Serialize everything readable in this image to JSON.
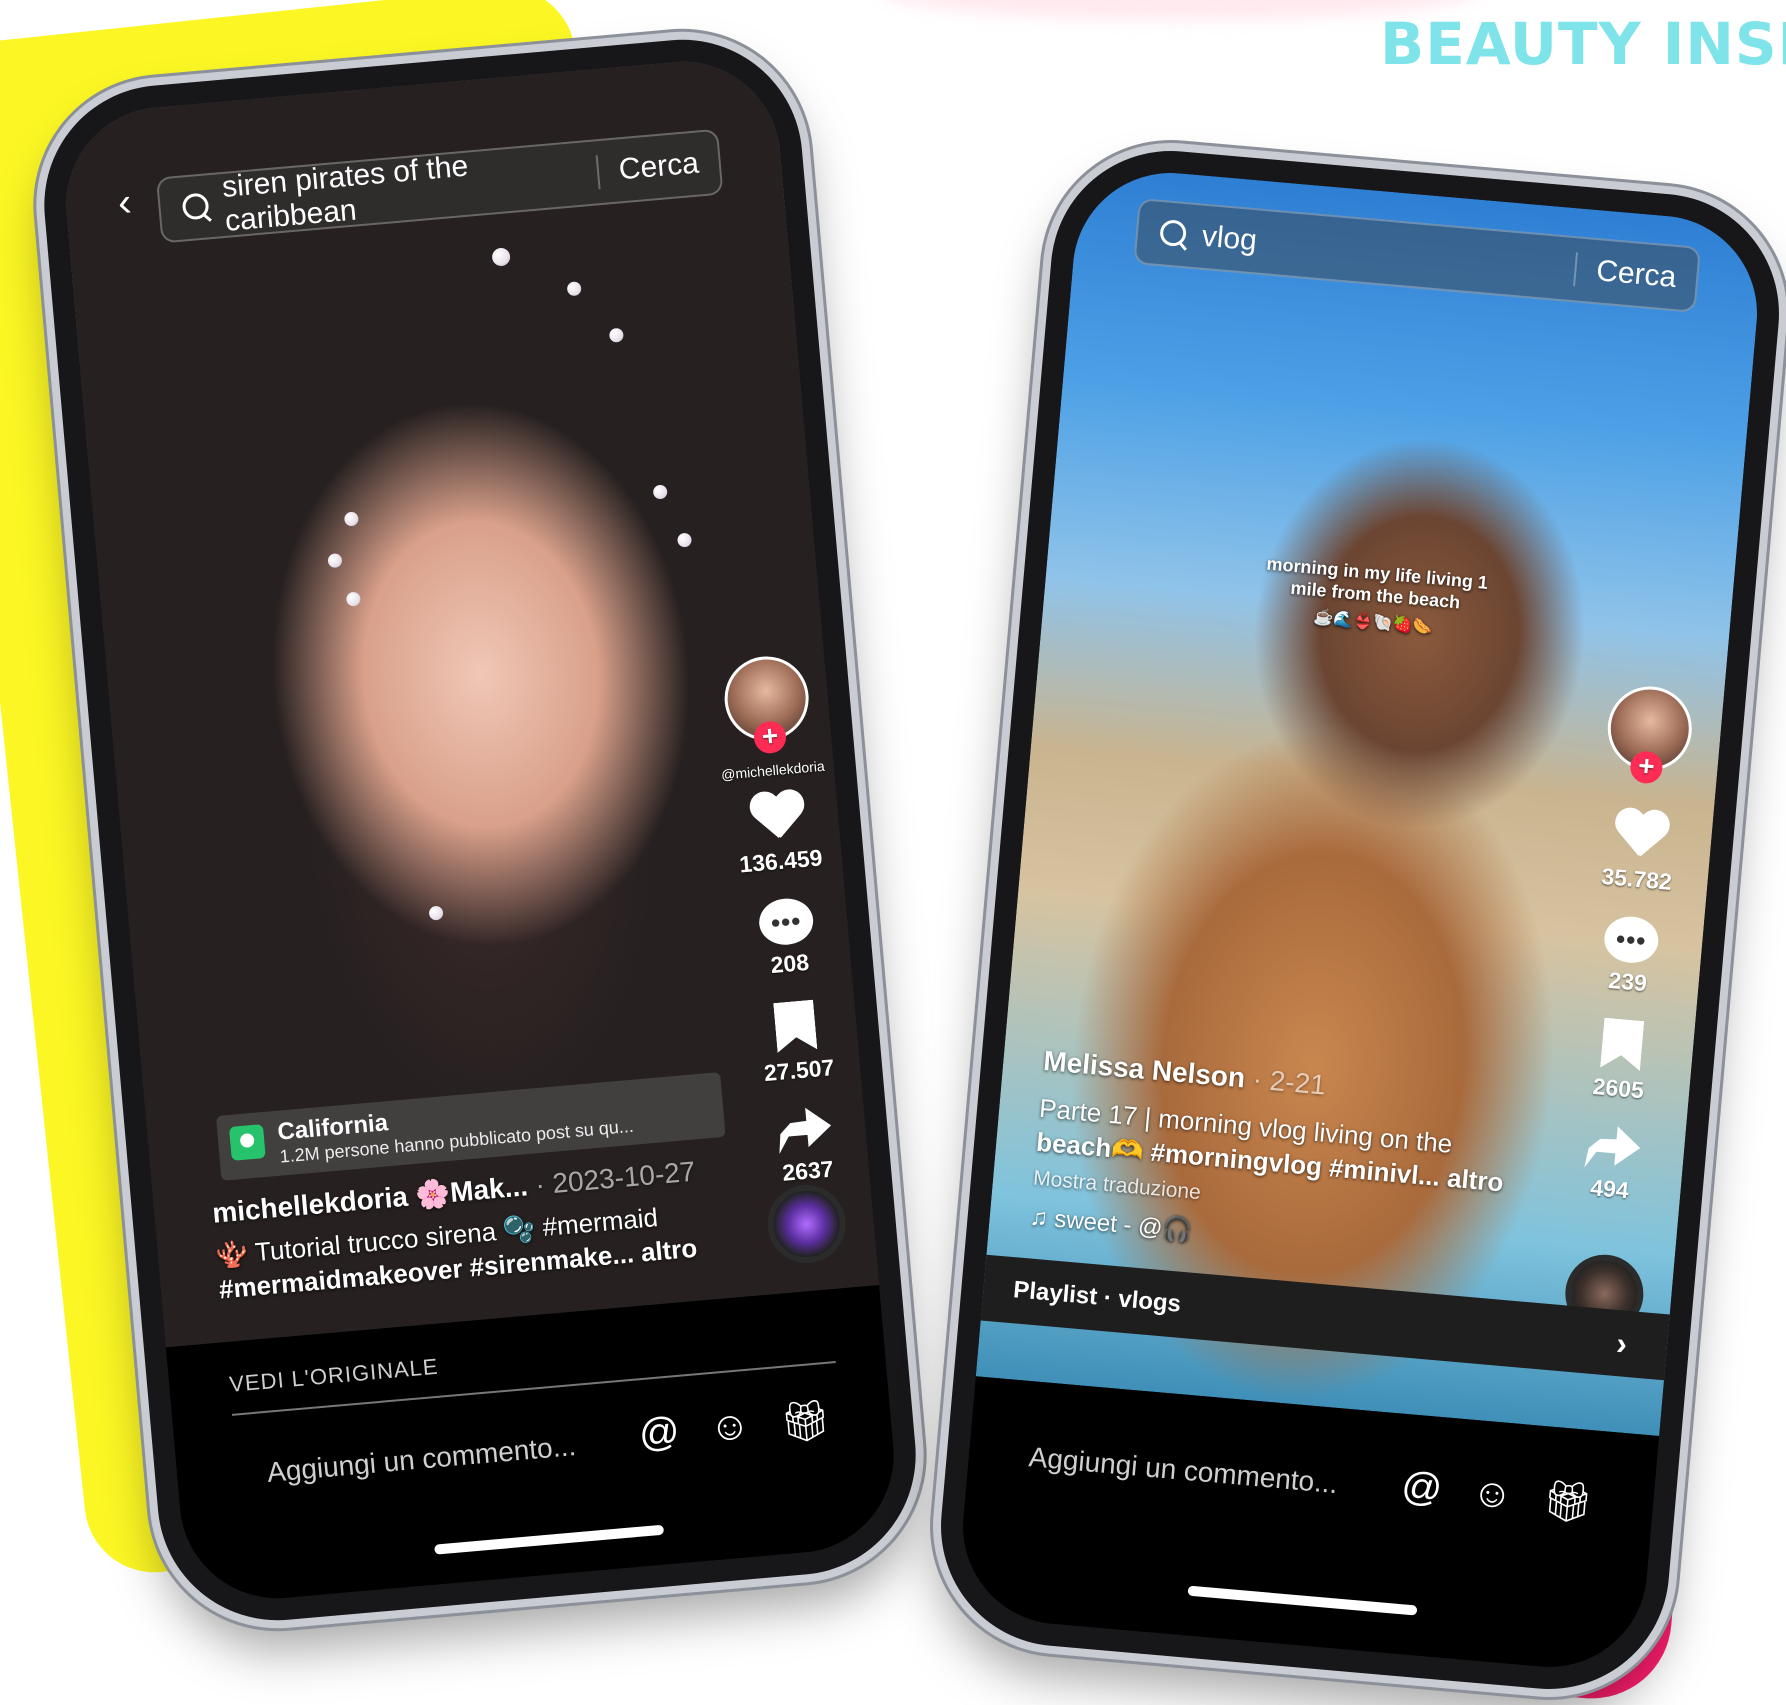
{
  "headline": "BEAUTY INSP",
  "colors": {
    "yellow": "#fbf624",
    "pink": "#ff1e6e",
    "headline": "#7fe3ea",
    "follow_plus": "#fe2c55",
    "location_pin": "#27c26c"
  },
  "left_phone": {
    "search": {
      "query": "siren pirates of the caribbean",
      "button": "Cerca"
    },
    "back_icon": "chevron-left-icon",
    "handle": "@michellekdoria",
    "follow_plus": "+",
    "likes": "136.459",
    "comments": "208",
    "saves": "27.507",
    "shares": "2637",
    "location": {
      "name": "California",
      "sub": "1.2M persone hanno pubblicato post su qu..."
    },
    "author_line": "michellekdoria 🌸Mak...",
    "date": "· 2023-10-27",
    "caption_1": "🪸 Tutorial trucco sirena 🫧 #mermaid",
    "caption_2": "#mermaidmakeover #sirenmake... altro",
    "see_original": "VEDI L'ORIGINALE",
    "comment_placeholder": "Aggiungi un commento...",
    "icons": [
      "at-icon",
      "emoji-icon",
      "gift-icon"
    ]
  },
  "right_phone": {
    "search": {
      "query": "vlog",
      "button": "Cerca"
    },
    "overlay_text": "morning in my life living 1 mile from the beach",
    "overlay_emoji": "☕🌊👙🐚🍓🌭",
    "follow_plus": "+",
    "likes": "35.782",
    "comments": "239",
    "saves": "2605",
    "shares": "494",
    "author": "Melissa Nelson",
    "date": "· 2-21",
    "caption_1": "Parte 17 | morning vlog living on the",
    "caption_2": "beach🫶 #morningvlog #minivl... altro",
    "translate": "Mostra traduzione",
    "sound": "♫ sweet - @🎧",
    "playlist": "Playlist · vlogs",
    "comment_placeholder": "Aggiungi un commento...",
    "icons": [
      "at-icon",
      "emoji-icon",
      "gift-icon"
    ]
  }
}
